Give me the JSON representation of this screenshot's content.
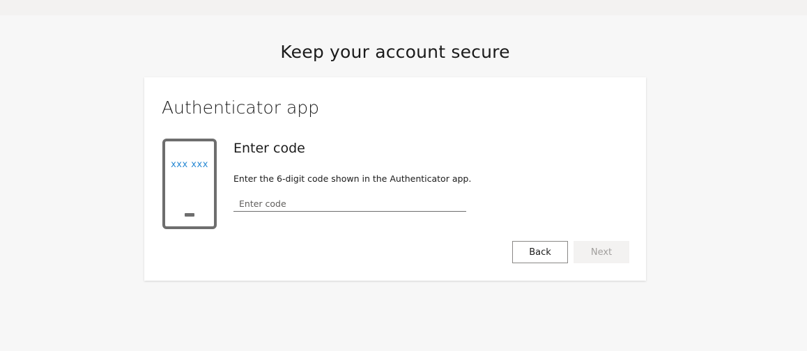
{
  "page": {
    "title": "Keep your account secure"
  },
  "card": {
    "title": "Authenticator app",
    "phone_code_display": "xxx xxx",
    "section_title": "Enter code",
    "instructions": "Enter the 6-digit code shown in the Authenticator app.",
    "code_input": {
      "value": "",
      "placeholder": "Enter code"
    },
    "buttons": {
      "back_label": "Back",
      "next_label": "Next",
      "next_disabled": true
    }
  },
  "colors": {
    "background": "#f7f7f7",
    "card": "#ffffff",
    "phone_code": "#2a8ad4",
    "phone_frame": "#6e6e6e",
    "disabled_button": "#f3f2f1"
  },
  "icons": {
    "phone": "smartphone-icon"
  }
}
